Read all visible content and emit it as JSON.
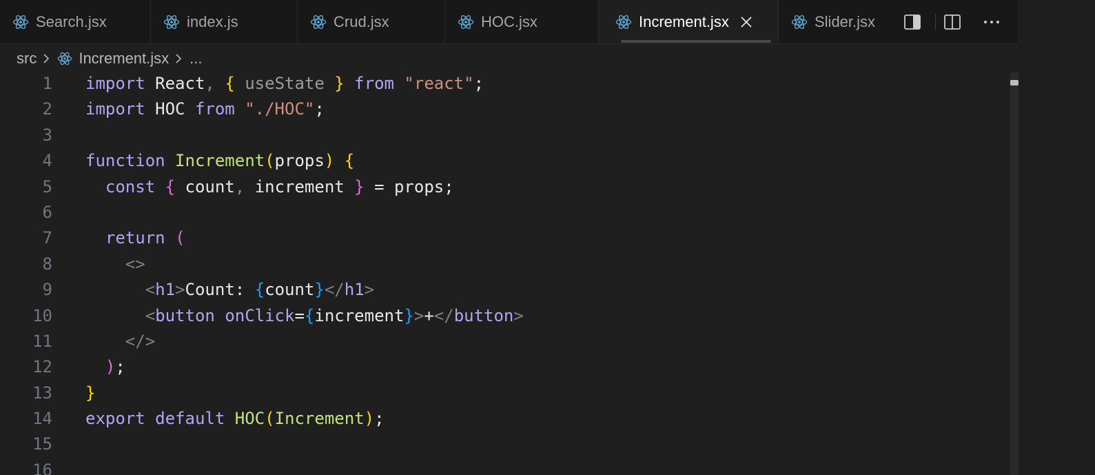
{
  "tabs": [
    {
      "label": "Search.jsx",
      "icon": "react-icon",
      "active": false
    },
    {
      "label": "index.js",
      "icon": "react-icon",
      "active": false
    },
    {
      "label": "Crud.jsx",
      "icon": "react-icon",
      "active": false
    },
    {
      "label": "HOC.jsx",
      "icon": "react-icon",
      "active": false
    },
    {
      "label": "Increment.jsx",
      "icon": "react-icon",
      "active": true
    },
    {
      "label": "Slider.jsx",
      "icon": "react-icon",
      "active": false
    }
  ],
  "tab_actions": [
    "toggle-panel-icon",
    "split-editor-icon",
    "more-actions-icon"
  ],
  "breadcrumb": {
    "folder": "src",
    "file": "Increment.jsx",
    "more": "..."
  },
  "code": {
    "line_numbers": [
      "1",
      "2",
      "3",
      "4",
      "5",
      "6",
      "7",
      "8",
      "9",
      "10",
      "11",
      "12",
      "13",
      "14",
      "15",
      "16"
    ],
    "lines": [
      [
        [
          "kw",
          "import"
        ],
        [
          "id",
          " React"
        ],
        [
          "punc",
          ", "
        ],
        [
          "brace1",
          "{"
        ],
        [
          "dim",
          " useState "
        ],
        [
          "brace1",
          "}"
        ],
        [
          "kw",
          " from "
        ],
        [
          "str",
          "\"react\""
        ],
        [
          "id",
          ";"
        ]
      ],
      [
        [
          "kw",
          "import"
        ],
        [
          "id",
          " HOC "
        ],
        [
          "kw",
          "from "
        ],
        [
          "str",
          "\"./HOC\""
        ],
        [
          "id",
          ";"
        ]
      ],
      [],
      [
        [
          "kw",
          "function"
        ],
        [
          "id",
          " "
        ],
        [
          "green",
          "Increment"
        ],
        [
          "brace1",
          "("
        ],
        [
          "id",
          "props"
        ],
        [
          "brace1",
          ")"
        ],
        [
          "id",
          " "
        ],
        [
          "brace1",
          "{"
        ]
      ],
      [
        [
          "id",
          "  "
        ],
        [
          "kw",
          "const"
        ],
        [
          "id",
          " "
        ],
        [
          "brace2",
          "{"
        ],
        [
          "id",
          " count"
        ],
        [
          "punc",
          ","
        ],
        [
          "id",
          " increment "
        ],
        [
          "brace2",
          "}"
        ],
        [
          "id",
          " = props;"
        ]
      ],
      [],
      [
        [
          "id",
          "  "
        ],
        [
          "kw",
          "return"
        ],
        [
          "id",
          " "
        ],
        [
          "brace2",
          "("
        ]
      ],
      [
        [
          "id",
          "    "
        ],
        [
          "angle",
          "<>"
        ]
      ],
      [
        [
          "id",
          "      "
        ],
        [
          "angle",
          "<"
        ],
        [
          "tag",
          "h1"
        ],
        [
          "angle",
          ">"
        ],
        [
          "text",
          "Count: "
        ],
        [
          "brace3",
          "{"
        ],
        [
          "id",
          "count"
        ],
        [
          "brace3",
          "}"
        ],
        [
          "angle",
          "</"
        ],
        [
          "tag",
          "h1"
        ],
        [
          "angle",
          ">"
        ]
      ],
      [
        [
          "id",
          "      "
        ],
        [
          "angle",
          "<"
        ],
        [
          "tag",
          "button"
        ],
        [
          "id",
          " "
        ],
        [
          "attr",
          "onClick"
        ],
        [
          "id",
          "="
        ],
        [
          "brace3",
          "{"
        ],
        [
          "id",
          "increment"
        ],
        [
          "brace3",
          "}"
        ],
        [
          "angle",
          ">"
        ],
        [
          "text",
          "+"
        ],
        [
          "angle",
          "</"
        ],
        [
          "tag",
          "button"
        ],
        [
          "angle",
          ">"
        ]
      ],
      [
        [
          "id",
          "    "
        ],
        [
          "angle",
          "</>"
        ]
      ],
      [
        [
          "id",
          "  "
        ],
        [
          "brace2",
          ")"
        ],
        [
          "id",
          ";"
        ]
      ],
      [
        [
          "brace1",
          "}"
        ]
      ],
      [
        [
          "kw",
          "export"
        ],
        [
          "id",
          " "
        ],
        [
          "kw",
          "default"
        ],
        [
          "id",
          " "
        ],
        [
          "green",
          "HOC"
        ],
        [
          "brace1",
          "("
        ],
        [
          "green",
          "Increment"
        ],
        [
          "brace1",
          ")"
        ],
        [
          "id",
          ";"
        ]
      ],
      [],
      []
    ]
  },
  "colors": {
    "background": "#1f1f1f",
    "tab_bar": "#181818",
    "keyword": "#b4a4f5",
    "function_name": "#c5e478",
    "string": "#ce9178",
    "bracket_gold": "#ffd700",
    "bracket_pink": "#da70d6",
    "bracket_blue": "#179fff",
    "react_icon": "#5fa8d3"
  }
}
